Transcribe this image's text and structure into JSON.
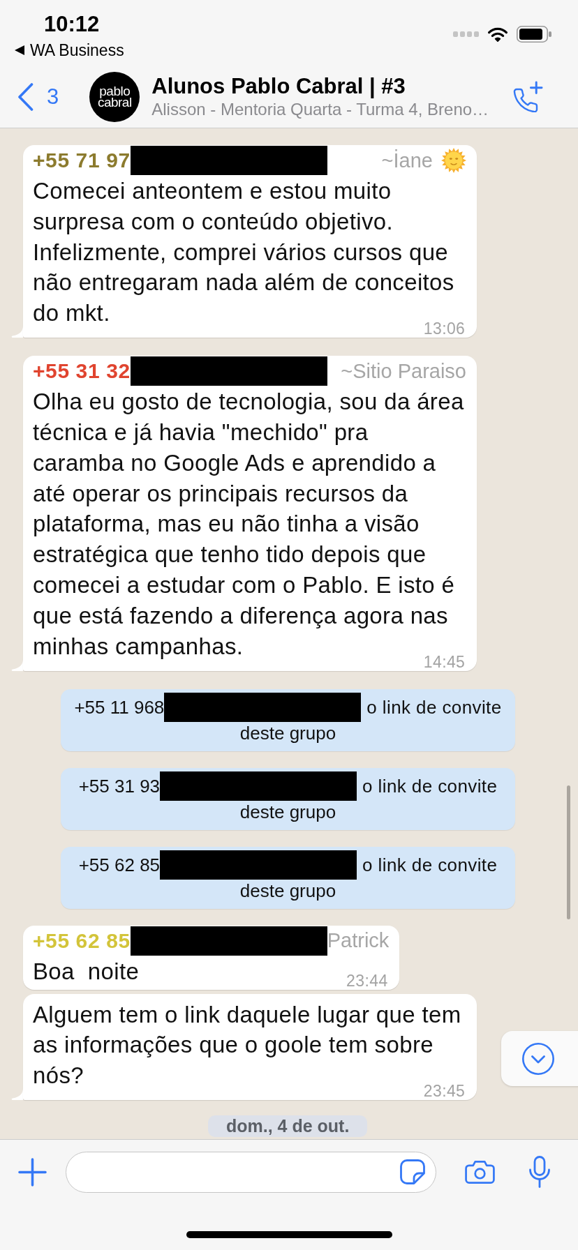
{
  "status_bar": {
    "time": "10:12",
    "back_link": "WA Business"
  },
  "header": {
    "back_count": "3",
    "avatar_logo": "pablo cabral",
    "title": "Alunos Pablo Cabral | #3",
    "subtitle": "Alisson - Mentoria Quarta - Turma 4, Breno…"
  },
  "chat": [
    {
      "kind": "message",
      "sender_number": "+55 71 97",
      "sender_name": "~İane",
      "name_emoji": true,
      "color": "#8c7b2e",
      "text": "Comecei anteontem e estou muito surpresa com o conteúdo objetivo. Infelizmente, comprei vários cursos que não entregaram nada além de conceitos do mkt.",
      "time": "13:06",
      "tail": true
    },
    {
      "kind": "message",
      "sender_number": "+55 31 32",
      "sender_name": "~Sitio Paraiso",
      "name_emoji": false,
      "color": "#e0442f",
      "text": "Olha eu gosto de tecnologia, sou da área técnica e já havia \"mechido\" pra caramba no Google Ads e aprendido a até operar os principais recursos da plataforma, mas eu não tinha a visão estratégica que tenho tido depois que comecei a estudar com o Pablo. E isto é que está fazendo a diferença agora nas minhas campanhas.",
      "time": "14:45",
      "tail": true
    },
    {
      "kind": "system",
      "start": "+55 11 968",
      "end": "o link de convite",
      "line_2": "deste grupo"
    },
    {
      "kind": "system",
      "start": "+55 31 93",
      "end": "o link de convite",
      "line_2": "deste grupo"
    },
    {
      "kind": "system",
      "start": "+55 62 85",
      "end": "o link de convite",
      "line_2": "deste grupo"
    },
    {
      "kind": "message",
      "sender_number": "+55 62 85",
      "sender_name": "Patrick",
      "name_emoji": false,
      "color": "#d3c43a",
      "text": "Boa  noite",
      "time": "23:44",
      "tail": false
    },
    {
      "kind": "message",
      "text": "Alguem tem o link daquele lugar que tem as informações que o goole tem sobre nós?",
      "time": "23:45",
      "tail": true
    },
    {
      "kind": "date",
      "label": "dom., 4 de out."
    }
  ]
}
